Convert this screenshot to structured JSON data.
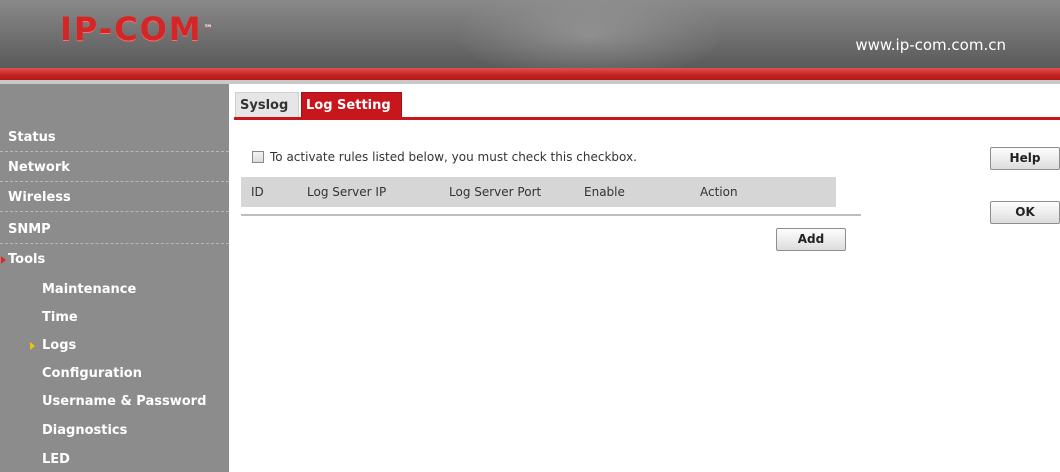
{
  "header": {
    "logo": "IP-COM",
    "logo_tm": "™",
    "url": "www.ip-com.com.cn"
  },
  "sidebar": {
    "items": [
      {
        "label": "Status"
      },
      {
        "label": "Network"
      },
      {
        "label": "Wireless"
      },
      {
        "label": "SNMP"
      },
      {
        "label": "Tools",
        "active": true
      }
    ],
    "subitems": [
      {
        "label": "Maintenance"
      },
      {
        "label": "Time"
      },
      {
        "label": "Logs",
        "active": true
      },
      {
        "label": "Configuration"
      },
      {
        "label": "Username & Password"
      },
      {
        "label": "Diagnostics"
      },
      {
        "label": "LED"
      }
    ]
  },
  "tabs": [
    {
      "label": "Syslog",
      "active": false
    },
    {
      "label": "Log Setting",
      "active": true
    }
  ],
  "main": {
    "checkbox_label": "To activate rules listed below, you must check this checkbox.",
    "checkbox_checked": false,
    "columns": [
      "ID",
      "Log Server IP",
      "Log Server Port",
      "Enable",
      "Action"
    ],
    "rows": [],
    "add_label": "Add"
  },
  "actions": {
    "help_label": "Help",
    "ok_label": "OK"
  },
  "colors": {
    "accent": "#c8161d",
    "sidebar_bg": "#8c8c8c",
    "header_bg": "#7a7a7a"
  }
}
